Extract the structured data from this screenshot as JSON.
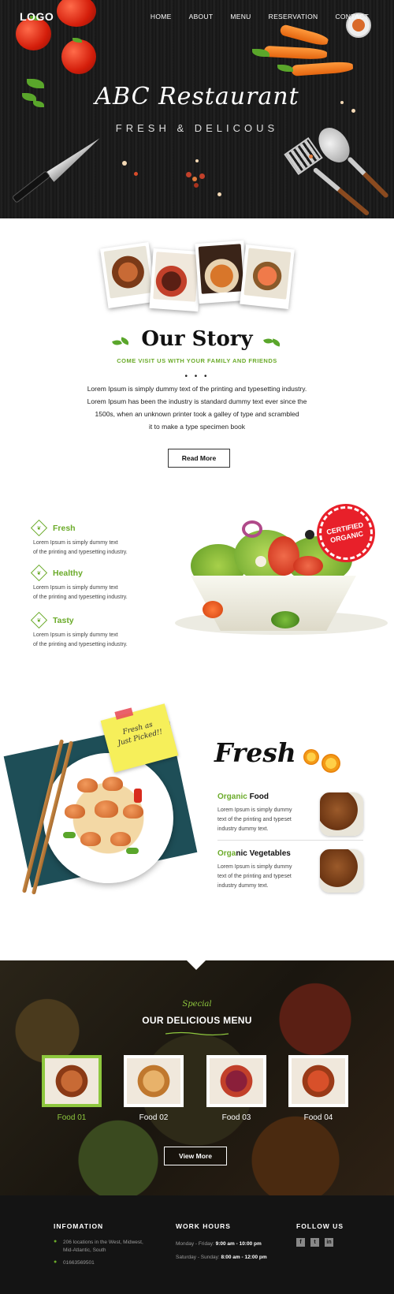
{
  "header": {
    "logo": "LOGO",
    "nav": [
      "HOME",
      "ABOUT",
      "MENU",
      "RESERVATION",
      "CONTACT"
    ]
  },
  "hero": {
    "title": "ABC Restaurant",
    "subtitle": "FRESH & DELICOUS"
  },
  "story": {
    "title": "Our Story",
    "tagline": "COME VISIT US WITH YOUR FAMILY AND FRIENDS",
    "text_lines": [
      "Lorem Ipsum is simply dummy text of the printing and typesetting industry.",
      "Lorem Ipsum has been the industry is standard dummy text ever since the",
      "1500s, when an unknown printer took a galley of type and scrambled",
      "it to make a type specimen book"
    ],
    "button": "Read More"
  },
  "features": [
    {
      "title": "Fresh",
      "lines": [
        "Lorem Ipsum is simply dummy text",
        "of the printing and typesetting industry."
      ]
    },
    {
      "title": "Healthy",
      "lines": [
        "Lorem Ipsum is simply dummy text",
        "of the printing and typesetting industry."
      ]
    },
    {
      "title": "Tasty",
      "lines": [
        "Lorem Ipsum is simply dummy text",
        "of the printing and typesetting industry."
      ]
    }
  ],
  "badge": {
    "line1": "CERTIFIED",
    "line2": "ORGANIC"
  },
  "note": {
    "line1": "Fresh as",
    "line2": "Just Picked!!"
  },
  "fresh": {
    "title": "Fresh",
    "items": [
      {
        "title_green": "Organic",
        "title_rest": " Food",
        "lines": [
          "Lorem Ipsum is simply dummy",
          "text of the printing and typeset",
          "industry dummy text."
        ]
      },
      {
        "title_green": "Orga",
        "title_rest": "nic Vegetables",
        "lines": [
          "Lorem Ipsum is simply dummy",
          "text of the printing and typeset",
          "industry dummy text."
        ]
      }
    ]
  },
  "special": {
    "label": "Special",
    "title": "OUR DELICIOUS MENU",
    "foods": [
      "Food 01",
      "Food 02",
      "Food 03",
      "Food 04"
    ],
    "button": "View More"
  },
  "footer": {
    "info_title": "INFOMATION",
    "address_1": "206 locations in the West, Midwest,",
    "address_2": "Mid-Atlantic, South",
    "phone": "01663569501",
    "hours_title": "WORK HOURS",
    "weekday_label": "Monday - Friday:",
    "weekday_hours": "9:00 am - 10:00 pm",
    "weekend_label": "Saturday - Sunday:",
    "weekend_hours": "8:00 am - 12:00 pm",
    "follow_title": "FOLLOW US",
    "social": [
      "f",
      "t",
      "in"
    ]
  },
  "colors": {
    "accent": "#6bab2a",
    "accent_light": "#8ec73e",
    "badge": "#e8202a",
    "dark": "#141414"
  }
}
